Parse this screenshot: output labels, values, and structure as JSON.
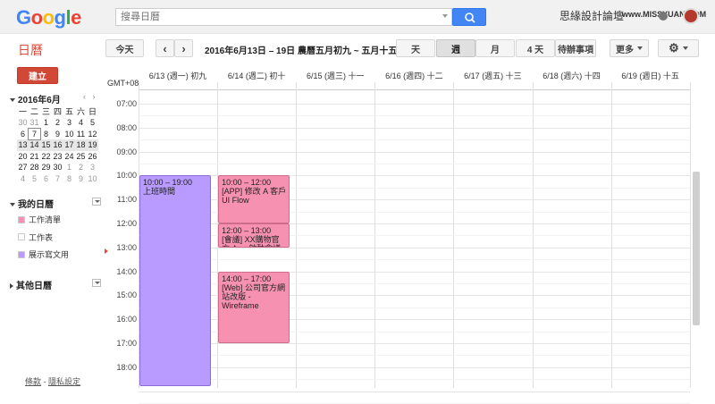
{
  "header": {
    "logo_letters": [
      {
        "ch": "G",
        "color": "#4285f4"
      },
      {
        "ch": "o",
        "color": "#ea4335"
      },
      {
        "ch": "o",
        "color": "#fbbc05"
      },
      {
        "ch": "g",
        "color": "#4285f4"
      },
      {
        "ch": "l",
        "color": "#34a853"
      },
      {
        "ch": "e",
        "color": "#ea4335"
      }
    ],
    "search_placeholder": "搜尋日曆",
    "watermark": "思緣設計論壇",
    "watermark_url": "www.MISSYUAN.COM"
  },
  "toolbar": {
    "app_title": "日曆",
    "today_label": "今天",
    "prev_icon": "‹",
    "next_icon": "›",
    "date_range": "2016年6月13日 – 19日 農曆五月初九 ~ 五月十五",
    "views": [
      {
        "label": "天",
        "active": false
      },
      {
        "label": "週",
        "active": true
      },
      {
        "label": "月",
        "active": false
      },
      {
        "label": "4 天",
        "active": false
      },
      {
        "label": "待辦事項",
        "active": false
      }
    ],
    "more_label": "更多",
    "settings_icon": "⚙"
  },
  "sidebar": {
    "create_label": "建立",
    "mini_cal": {
      "title": "2016年6月",
      "weekdays": [
        "一",
        "二",
        "三",
        "四",
        "五",
        "六",
        "日"
      ],
      "weeks": [
        [
          {
            "d": "30",
            "o": true
          },
          {
            "d": "31",
            "o": true
          },
          {
            "d": "1"
          },
          {
            "d": "2"
          },
          {
            "d": "3"
          },
          {
            "d": "4"
          },
          {
            "d": "5"
          }
        ],
        [
          {
            "d": "6"
          },
          {
            "d": "7",
            "t": true
          },
          {
            "d": "8"
          },
          {
            "d": "9"
          },
          {
            "d": "10"
          },
          {
            "d": "11"
          },
          {
            "d": "12"
          }
        ],
        [
          {
            "d": "13"
          },
          {
            "d": "14"
          },
          {
            "d": "15"
          },
          {
            "d": "16"
          },
          {
            "d": "17"
          },
          {
            "d": "18"
          },
          {
            "d": "19"
          }
        ],
        [
          {
            "d": "20"
          },
          {
            "d": "21"
          },
          {
            "d": "22"
          },
          {
            "d": "23"
          },
          {
            "d": "24"
          },
          {
            "d": "25"
          },
          {
            "d": "26"
          }
        ],
        [
          {
            "d": "27"
          },
          {
            "d": "28"
          },
          {
            "d": "29"
          },
          {
            "d": "30"
          },
          {
            "d": "1",
            "o": true
          },
          {
            "d": "2",
            "o": true
          },
          {
            "d": "3",
            "o": true
          }
        ],
        [
          {
            "d": "4",
            "o": true
          },
          {
            "d": "5",
            "o": true
          },
          {
            "d": "6",
            "o": true
          },
          {
            "d": "7",
            "o": true
          },
          {
            "d": "8",
            "o": true
          },
          {
            "d": "9",
            "o": true
          },
          {
            "d": "10",
            "o": true
          }
        ]
      ],
      "highlight_week": 2
    },
    "my_calendars_label": "我的日曆",
    "calendars": [
      {
        "name": "工作清單",
        "color": "#f691b2"
      },
      {
        "name": "工作表",
        "color": "#ffffff"
      },
      {
        "name": "展示寫文用",
        "color": "#b99aff"
      }
    ],
    "other_calendars_label": "其他日曆",
    "footer_terms": "條款",
    "footer_sep": " - ",
    "footer_privacy": "隱私設定"
  },
  "grid": {
    "timezone": "GMT+08",
    "days": [
      "6/13 (週一) 初九",
      "6/14 (週二) 初十",
      "6/15 (週三) 十一",
      "6/16 (週四) 十二",
      "6/17 (週五) 十三",
      "6/18 (週六) 十四",
      "6/19 (週日) 十五"
    ],
    "hours": [
      "07:00",
      "08:00",
      "09:00",
      "10:00",
      "11:00",
      "12:00",
      "13:00",
      "14:00",
      "15:00",
      "16:00",
      "17:00",
      "18:00"
    ],
    "events": [
      {
        "day": 0,
        "start": 10,
        "end": 19.5,
        "time": "10:00 – 19:00",
        "title": "上班時間",
        "bg": "#b99aff",
        "border": "#8c6cd9"
      },
      {
        "day": 1,
        "start": 10,
        "end": 12,
        "time": "10:00 – 12:00",
        "title": "[APP] 修改 A 客戶 UI Flow",
        "bg": "#f691b2",
        "border": "#d06b8d"
      },
      {
        "day": 1,
        "start": 12,
        "end": 13,
        "time": "12:00 – 13:00",
        "title": "[會議] XX購物官方 App 啟動會議",
        "bg": "#f691b2",
        "border": "#d06b8d"
      },
      {
        "day": 1,
        "start": 14,
        "end": 17,
        "time": "14:00 – 17:00",
        "title": "[Web] 公司官方網站改版 - Wireframe",
        "bg": "#f691b2",
        "border": "#d06b8d"
      }
    ]
  }
}
